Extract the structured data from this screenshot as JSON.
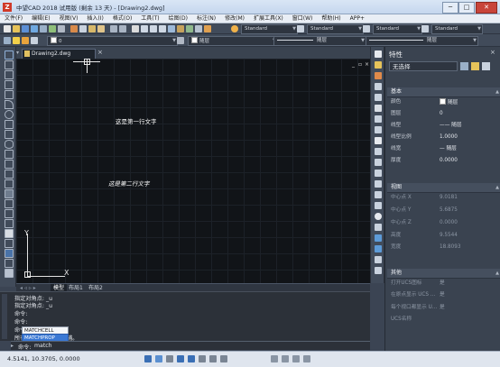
{
  "window": {
    "title": "中望CAD 2018 试用版 (剩余 13 天) - [Drawing2.dwg]",
    "min": "─",
    "max": "□",
    "close": "✕"
  },
  "menu": [
    "文件(F)",
    "编辑(E)",
    "视图(V)",
    "插入(I)",
    "格式(O)",
    "工具(T)",
    "绘图(D)",
    "标注(N)",
    "修改(M)",
    "扩展工具(X)",
    "窗口(W)",
    "帮助(H)",
    "APP+"
  ],
  "toolbar1": {
    "style1": "Standard",
    "style2": "Standard",
    "style3": "Standard",
    "style4": "Standard"
  },
  "toolbar2": {
    "layer": "0",
    "color": "随层",
    "linetype": "随层",
    "lineweight": "随层"
  },
  "doc_tab": {
    "label": "Drawing2.dwg",
    "close": "×"
  },
  "viewport": {
    "min": "_",
    "restore": "▫",
    "close": "×"
  },
  "canvas_text": {
    "line1": "这是第一行文字",
    "line2": "这是第二行文字"
  },
  "ucs": {
    "x": "X",
    "y": "Y"
  },
  "layout_tabs": {
    "model": "模型",
    "layout1": "布局1",
    "layout2": "布局2"
  },
  "command_history": [
    "指定对角点: _u",
    "指定对角点: _u",
    "命令:",
    "命令:",
    "命令:",
    "所有对象"
  ],
  "command_history_tail": "捕。",
  "autocomplete": [
    "MATCHCELL",
    "MATCHPROP"
  ],
  "command_input": {
    "prompt": "命令:",
    "value": "match"
  },
  "status": {
    "coords": "4.5141, 10.3705, 0.0000"
  },
  "properties": {
    "title": "特性",
    "selection": "无选择",
    "sections": {
      "basic": {
        "label": "基本",
        "rows": [
          {
            "k": "颜色",
            "v": "随层"
          },
          {
            "k": "图层",
            "v": "0"
          },
          {
            "k": "线型",
            "v": "—— 随层"
          },
          {
            "k": "线型比例",
            "v": "1.0000"
          },
          {
            "k": "线宽",
            "v": "— 随层"
          },
          {
            "k": "厚度",
            "v": "0.0000"
          }
        ]
      },
      "view": {
        "label": "视图",
        "rows": [
          {
            "k": "中心点 X",
            "v": "9.0181"
          },
          {
            "k": "中心点 Y",
            "v": "5.6875"
          },
          {
            "k": "中心点 Z",
            "v": "0.0000"
          },
          {
            "k": "高度",
            "v": "9.5544"
          },
          {
            "k": "宽度",
            "v": "18.8093"
          }
        ]
      },
      "misc": {
        "label": "其他",
        "rows": [
          {
            "k": "打开UCS图标",
            "v": "是"
          },
          {
            "k": "在原点显示 UCS ...",
            "v": "是"
          },
          {
            "k": "每个视口都显示 U...",
            "v": "是"
          },
          {
            "k": "UCS名称",
            "v": ""
          }
        ]
      }
    }
  }
}
